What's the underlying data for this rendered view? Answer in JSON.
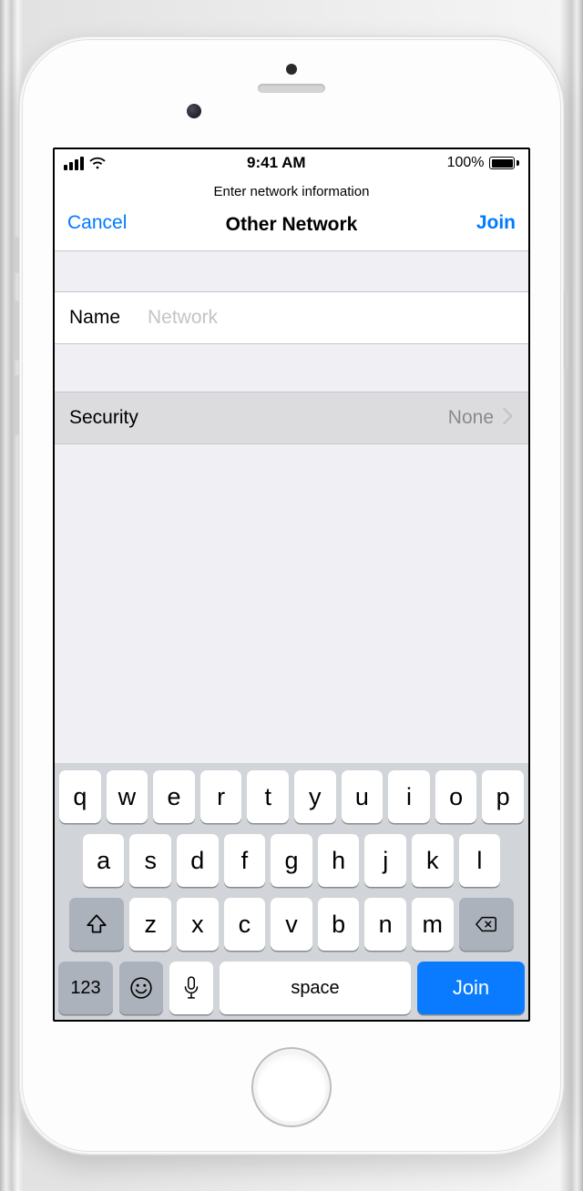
{
  "statusbar": {
    "time": "9:41 AM",
    "battery": "100%"
  },
  "header": {
    "subtitle": "Enter network information",
    "cancel": "Cancel",
    "title": "Other Network",
    "join": "Join"
  },
  "form": {
    "name_label": "Name",
    "name_placeholder": "Network",
    "name_value": "",
    "security_label": "Security",
    "security_value": "None"
  },
  "keyboard": {
    "row1": [
      "q",
      "w",
      "e",
      "r",
      "t",
      "y",
      "u",
      "i",
      "o",
      "p"
    ],
    "row2": [
      "a",
      "s",
      "d",
      "f",
      "g",
      "h",
      "j",
      "k",
      "l"
    ],
    "row3": [
      "z",
      "x",
      "c",
      "v",
      "b",
      "n",
      "m"
    ],
    "numkey": "123",
    "space": "space",
    "join": "Join"
  }
}
